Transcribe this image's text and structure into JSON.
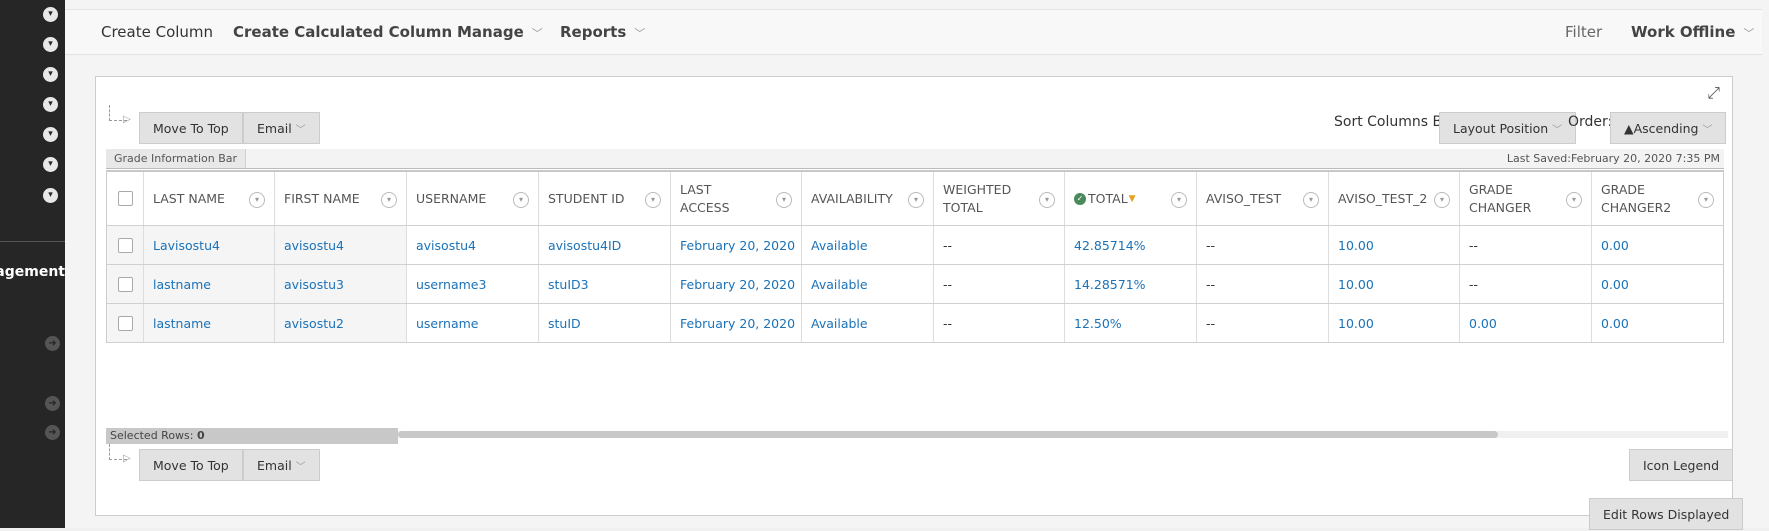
{
  "sidebar": {
    "menu_text": "Course Management"
  },
  "action_bar": {
    "create_column": "Create Column",
    "create_calculated_column": "Create Calculated Column",
    "manage": "Manage",
    "reports": "Reports",
    "filter": "Filter",
    "work_offline": "Work Offline"
  },
  "toolbar": {
    "move_to_top": "Move To Top",
    "email": "Email",
    "sort_columns_by_label": "Sort Columns By:",
    "sort_columns_by_value": "Layout Position",
    "order_label": "Order:",
    "order_value": "▲Ascending"
  },
  "info_bar": {
    "tab": "Grade Information Bar",
    "last_saved": "Last Saved:February 20, 2020 7:35 PM"
  },
  "grid": {
    "headers": {
      "last_name": "LAST NAME",
      "first_name": "FIRST NAME",
      "username": "USERNAME",
      "student_id": "STUDENT ID",
      "last_access": "LAST ACCESS",
      "availability": "AVAILABILITY",
      "weighted_total": "WEIGHTED TOTAL",
      "total": "TOTAL",
      "aviso_test": "AVISO_TEST",
      "aviso_test_2": "AVISO_TEST_2",
      "grade_changer": "GRADE CHANGER",
      "grade_changer2": "GRADE CHANGER2"
    },
    "rows": [
      {
        "last_name": "Lavisostu4",
        "first_name": "avisostu4",
        "username": "avisostu4",
        "student_id": "avisostu4ID",
        "last_access": "February 20, 2020",
        "availability": "Available",
        "weighted_total": "--",
        "total": "42.85714%",
        "aviso_test": "--",
        "aviso_test_2": "10.00",
        "grade_changer": "--",
        "grade_changer2": "0.00"
      },
      {
        "last_name": "lastname",
        "first_name": "avisostu3",
        "username": "username3",
        "student_id": "stuID3",
        "last_access": "February 20, 2020",
        "availability": "Available",
        "weighted_total": "--",
        "total": "14.28571%",
        "aviso_test": "--",
        "aviso_test_2": "10.00",
        "grade_changer": "--",
        "grade_changer2": "0.00"
      },
      {
        "last_name": "lastname",
        "first_name": "avisostu2",
        "username": "username",
        "student_id": "stuID",
        "last_access": "February 20, 2020",
        "availability": "Available",
        "weighted_total": "--",
        "total": "12.50%",
        "aviso_test": "--",
        "aviso_test_2": "10.00",
        "grade_changer": "0.00",
        "grade_changer2": "0.00"
      }
    ]
  },
  "footer": {
    "selected_rows_label": "Selected Rows: ",
    "selected_rows_count": "0",
    "move_to_top": "Move To Top",
    "email": "Email",
    "icon_legend": "Icon Legend",
    "edit_rows_displayed": "Edit Rows Displayed"
  },
  "colors": {
    "sidebar_bg": "#262626",
    "link": "#1a72b8",
    "button_bg": "#e2e2e2"
  }
}
